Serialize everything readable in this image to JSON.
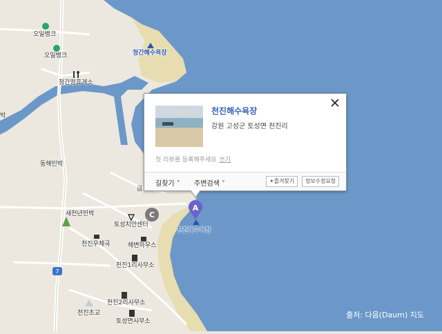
{
  "map": {
    "labels": {
      "oil_bank_1": "오일뱅크",
      "oil_bank_2": "오일뱅크",
      "cheonggan_rest_area": "청간정휴게소",
      "cheonggan_beach": "청간해수욕장",
      "donghae_minbak": "동해민박",
      "left_cut": "박",
      "saecheonnyeon_minbak": "새천년민박",
      "gosung_police": "토성치안센터",
      "cheonjin_post": "천진우체국",
      "haebyeon_house": "해변하우스",
      "cheonjin1ri_office": "천진1리사무소",
      "cheonjin2ri_office": "천진2리사무소",
      "cheonjin_school": "천진초교",
      "toseong_office": "토성면사무소",
      "cheonjin_beach": "천진해수욕장",
      "partial_geum": "금"
    },
    "route_shield": "7",
    "markers": {
      "a": "A",
      "c": "C"
    },
    "colors": {
      "sea": "#6b98c8",
      "land": "#ece8df",
      "sand": "#e8ddb0",
      "road": "#ffffff",
      "marker": "#6a63c9"
    }
  },
  "popup": {
    "title": "천진해수욕장",
    "address": "강원 고성군 토성면 천진리",
    "review_prompt": "첫 리뷰를 등록해주세요",
    "write_link": "쓰기",
    "directions": "길찾기",
    "nearby_search": "주변검색",
    "favorite": "즐겨찾기",
    "edit_request": "정보수정요청"
  },
  "credit": "출처: 다음(Daum) 지도"
}
